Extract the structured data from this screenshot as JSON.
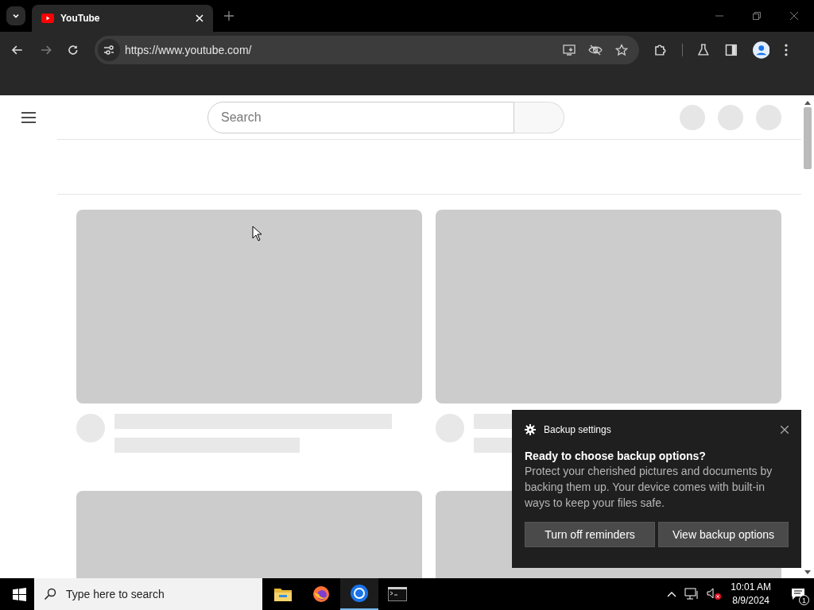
{
  "browser": {
    "tabs": [
      {
        "title": "YouTube",
        "selected": true
      }
    ],
    "url": "https://www.youtube.com/",
    "forward_disabled": true
  },
  "page": {
    "search": {
      "placeholder": "Search"
    },
    "placeholders": [
      {
        "kind": "video"
      },
      {
        "kind": "video"
      },
      {
        "kind": "thumbnail"
      },
      {
        "kind": "thumbnail"
      }
    ]
  },
  "notification": {
    "app": "Backup settings",
    "title": "Ready to choose backup options?",
    "body": "Protect your cherished pictures and documents by backing them up. Your device comes with built-in ways to keep your files safe.",
    "buttons": [
      "Turn off reminders",
      "View backup options"
    ]
  },
  "taskbar": {
    "search": {
      "placeholder": "Type here to search"
    },
    "apps": [
      {
        "kind": "folder",
        "selected": false
      },
      {
        "kind": "firefox",
        "selected": false
      },
      {
        "kind": "chrome",
        "selected": true
      },
      {
        "kind": "terminal",
        "selected": false
      }
    ],
    "time": "10:01 AM",
    "date": "8/9/2024",
    "notifications": "1"
  }
}
